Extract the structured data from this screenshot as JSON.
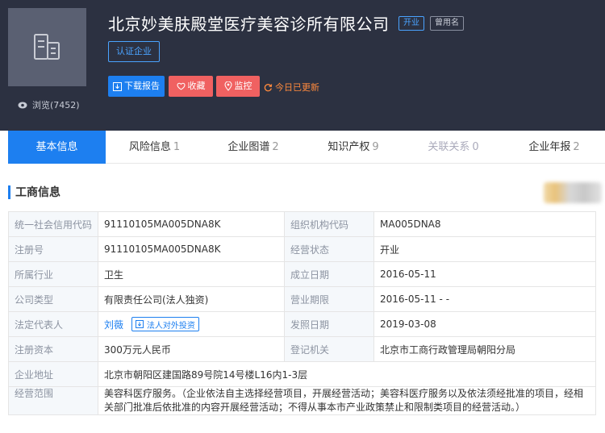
{
  "header": {
    "company_name": "北京妙美肤殿堂医疗美容诊所有限公司",
    "status_tag": "开业",
    "former_name_tag": "曾用名",
    "certified_label": "认证企业",
    "views_label": "浏览(7452)",
    "download_label": "下载报告",
    "collect_label": "收藏",
    "monitor_label": "监控",
    "updated_label": "今日已更新"
  },
  "tabs": [
    {
      "label": "基本信息",
      "count": ""
    },
    {
      "label": "风险信息",
      "count": "1"
    },
    {
      "label": "企业图谱",
      "count": "2"
    },
    {
      "label": "知识产权",
      "count": "9"
    },
    {
      "label": "关联关系",
      "count": "0"
    },
    {
      "label": "企业年报",
      "count": "2"
    }
  ],
  "section": {
    "title": "工商信息"
  },
  "info": {
    "credit_code_label": "统一社会信用代码",
    "credit_code": "91110105MA005DNA8K",
    "org_code_label": "组织机构代码",
    "org_code": "MA005DNA8",
    "reg_no_label": "注册号",
    "reg_no": "91110105MA005DNA8K",
    "biz_status_label": "经营状态",
    "biz_status": "开业",
    "industry_label": "所属行业",
    "industry": "卫生",
    "founded_label": "成立日期",
    "founded": "2016-05-11",
    "company_type_label": "公司类型",
    "company_type": "有限责任公司(法人独资)",
    "biz_term_label": "营业期限",
    "biz_term": "2016-05-11 - -",
    "legal_rep_label": "法定代表人",
    "legal_rep": "刘薇",
    "invest_label": "法人对外投资",
    "issue_date_label": "发照日期",
    "issue_date": "2019-03-08",
    "capital_label": "注册资本",
    "capital": "300万元人民币",
    "authority_label": "登记机关",
    "authority": "北京市工商行政管理局朝阳分局",
    "address_label": "企业地址",
    "address": "北京市朝阳区建国路89号院14号楼L16内1-3层",
    "scope_label": "经营范围",
    "scope": "美容科医疗服务。（企业依法自主选择经营项目，开展经营活动；美容科医疗服务以及依法须经批准的项目，经相关部门批准后依批准的内容开展经营活动；不得从事本市产业政策禁止和限制类项目的经营活动。）"
  },
  "colors": {
    "header_bg": "#2c3141",
    "accent": "#1d7ff0",
    "danger": "#f06161",
    "updated": "#ff8a3d"
  }
}
